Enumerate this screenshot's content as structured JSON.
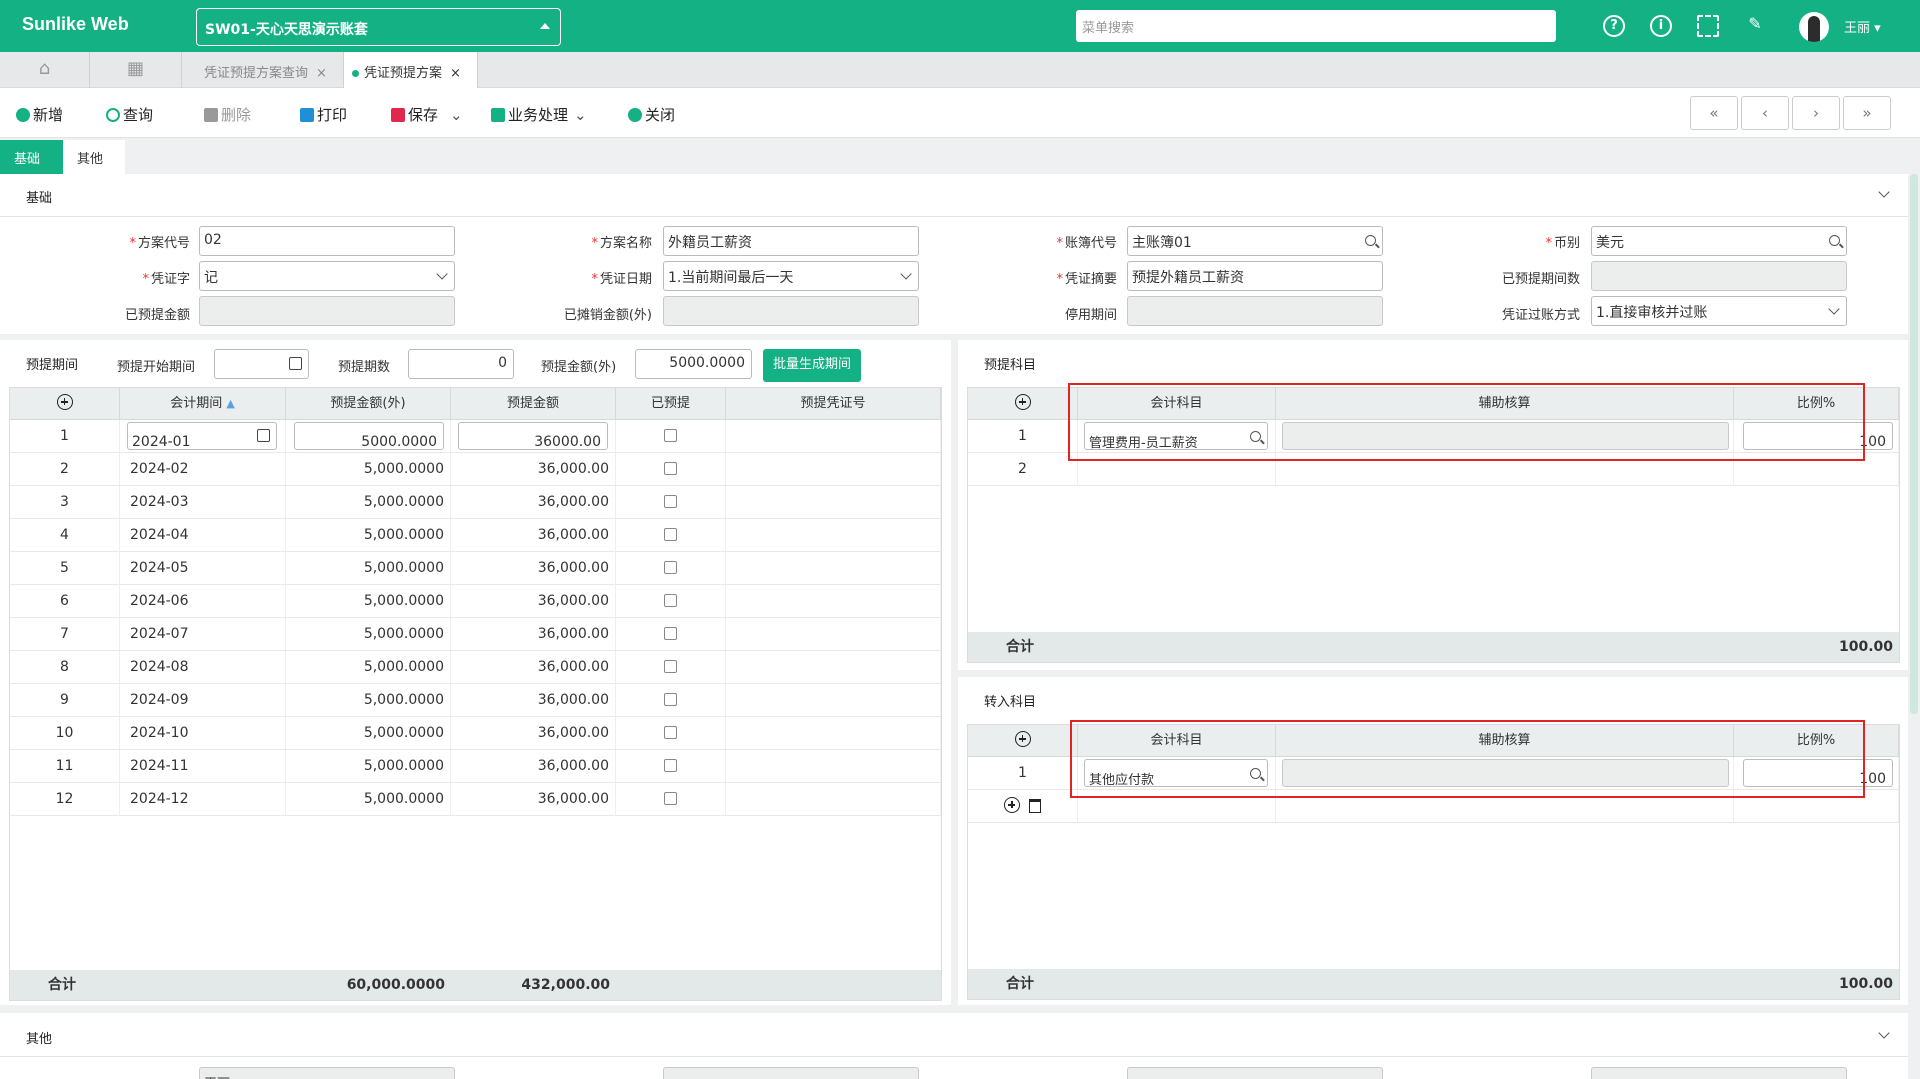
{
  "app": {
    "title": "Sunlike Web",
    "account": "SW01-天心天思演示账套",
    "menu_search_placeholder": "菜单搜索",
    "user": "王丽 ▾"
  },
  "tabs": [
    "凭证预提方案查询",
    "凭证预提方案"
  ],
  "toolbar": {
    "new": "新增",
    "query": "查询",
    "delete": "删除",
    "print": "打印",
    "save": "保存",
    "business": "业务处理",
    "close": "关闭"
  },
  "nav": {
    "first": "«",
    "prev": "‹",
    "next": "›",
    "last": "»"
  },
  "section_tabs": [
    "基础",
    "其他"
  ],
  "basic": {
    "title": "基础",
    "labels": {
      "plan_code": "方案代号",
      "plan_name": "方案名称",
      "book_code": "账簿代号",
      "currency": "币别",
      "voucher_word": "凭证字",
      "voucher_date": "凭证日期",
      "voucher_summary": "凭证摘要",
      "provisioned_periods": "已预提期间数",
      "provisioned_amount": "已预提金额",
      "amortized_amount_fc": "已摊销金额(外)",
      "disable_period": "停用期间",
      "posting_method": "凭证过账方式"
    },
    "values": {
      "plan_code": "02",
      "plan_name": "外籍员工薪资",
      "book_code": "主账簿01",
      "currency": "美元",
      "voucher_word": "记",
      "voucher_date": "1.当前期间最后一天",
      "voucher_summary": "预提外籍员工薪资",
      "posting_method": "1.直接审核并过账"
    }
  },
  "period": {
    "title": "预提期间",
    "labels": {
      "start": "预提开始期间",
      "count": "预提期数",
      "amount_fc": "预提金额(外)"
    },
    "values": {
      "count": "0",
      "amount_fc": "5000.0000"
    },
    "batch_button": "批量生成期间",
    "columns": [
      "会计期间",
      "预提金额(外)",
      "预提金额",
      "已预提",
      "预提凭证号"
    ],
    "first_row": {
      "no": "1",
      "period": "2024-01",
      "amount_fc": "5000.0000",
      "amount": "36000.00"
    },
    "rows": [
      {
        "no": "2",
        "period": "2024-02",
        "amount_fc": "5,000.0000",
        "amount": "36,000.00"
      },
      {
        "no": "3",
        "period": "2024-03",
        "amount_fc": "5,000.0000",
        "amount": "36,000.00"
      },
      {
        "no": "4",
        "period": "2024-04",
        "amount_fc": "5,000.0000",
        "amount": "36,000.00"
      },
      {
        "no": "5",
        "period": "2024-05",
        "amount_fc": "5,000.0000",
        "amount": "36,000.00"
      },
      {
        "no": "6",
        "period": "2024-06",
        "amount_fc": "5,000.0000",
        "amount": "36,000.00"
      },
      {
        "no": "7",
        "period": "2024-07",
        "amount_fc": "5,000.0000",
        "amount": "36,000.00"
      },
      {
        "no": "8",
        "period": "2024-08",
        "amount_fc": "5,000.0000",
        "amount": "36,000.00"
      },
      {
        "no": "9",
        "period": "2024-09",
        "amount_fc": "5,000.0000",
        "amount": "36,000.00"
      },
      {
        "no": "10",
        "period": "2024-10",
        "amount_fc": "5,000.0000",
        "amount": "36,000.00"
      },
      {
        "no": "11",
        "period": "2024-11",
        "amount_fc": "5,000.0000",
        "amount": "36,000.00"
      },
      {
        "no": "12",
        "period": "2024-12",
        "amount_fc": "5,000.0000",
        "amount": "36,000.00"
      }
    ],
    "footer": {
      "label": "合计",
      "amount_fc": "60,000.0000",
      "amount": "432,000.00"
    }
  },
  "accrual_subject": {
    "title": "预提科目",
    "columns": [
      "会计科目",
      "辅助核算",
      "比例%"
    ],
    "row1": {
      "no": "1",
      "subject": "管理费用-员工薪资",
      "ratio": "100"
    },
    "row2_no": "2",
    "footer": {
      "label": "合计",
      "ratio": "100.00"
    }
  },
  "transfer_subject": {
    "title": "转入科目",
    "columns": [
      "会计科目",
      "辅助核算",
      "比例%"
    ],
    "row1": {
      "no": "1",
      "subject": "其他应付款",
      "ratio": "100"
    },
    "footer": {
      "label": "合计",
      "ratio": "100.00"
    }
  },
  "other": {
    "title": "其他",
    "partial_value": "王丽"
  },
  "colors": {
    "brand": "#14b184",
    "highlight": "#e02424"
  }
}
